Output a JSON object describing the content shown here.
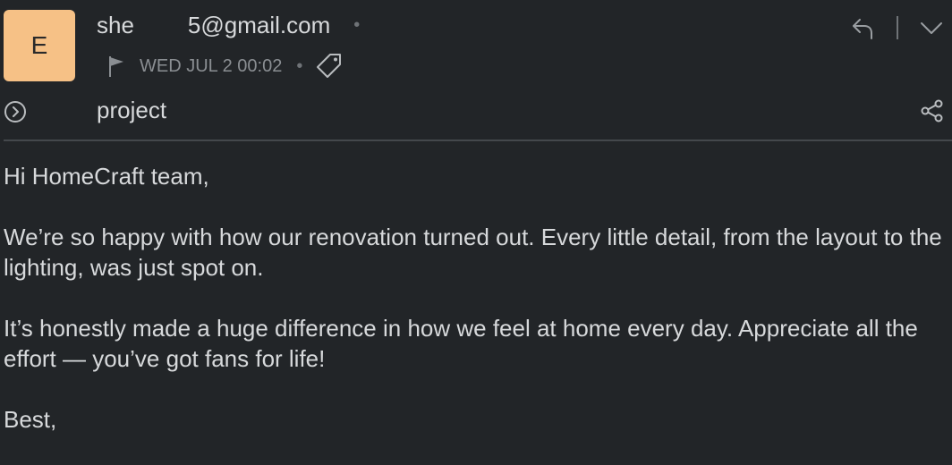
{
  "sender": {
    "avatar_letter": "E",
    "avatar_color": "#f6c186",
    "email_prefix": "she",
    "email_suffix": "5@gmail.com"
  },
  "meta": {
    "date": "WED JUL 2 00:02"
  },
  "subject": "project",
  "body": {
    "greeting": "Hi HomeCraft team,",
    "paragraph1": "We’re so happy with how our renovation turned out. Every little detail, from the layout to the lighting, was just spot on.",
    "paragraph2": "It’s honestly made a huge difference in how we feel at home every day. Appreciate all the effort — you’ve got fans for life!",
    "signoff": "Best,"
  },
  "icons": {
    "flag": "flag-icon",
    "tag": "tag-icon",
    "reply": "reply-icon",
    "more": "chevron-down-icon",
    "expand": "expand-circle-icon",
    "share": "share-icon"
  }
}
